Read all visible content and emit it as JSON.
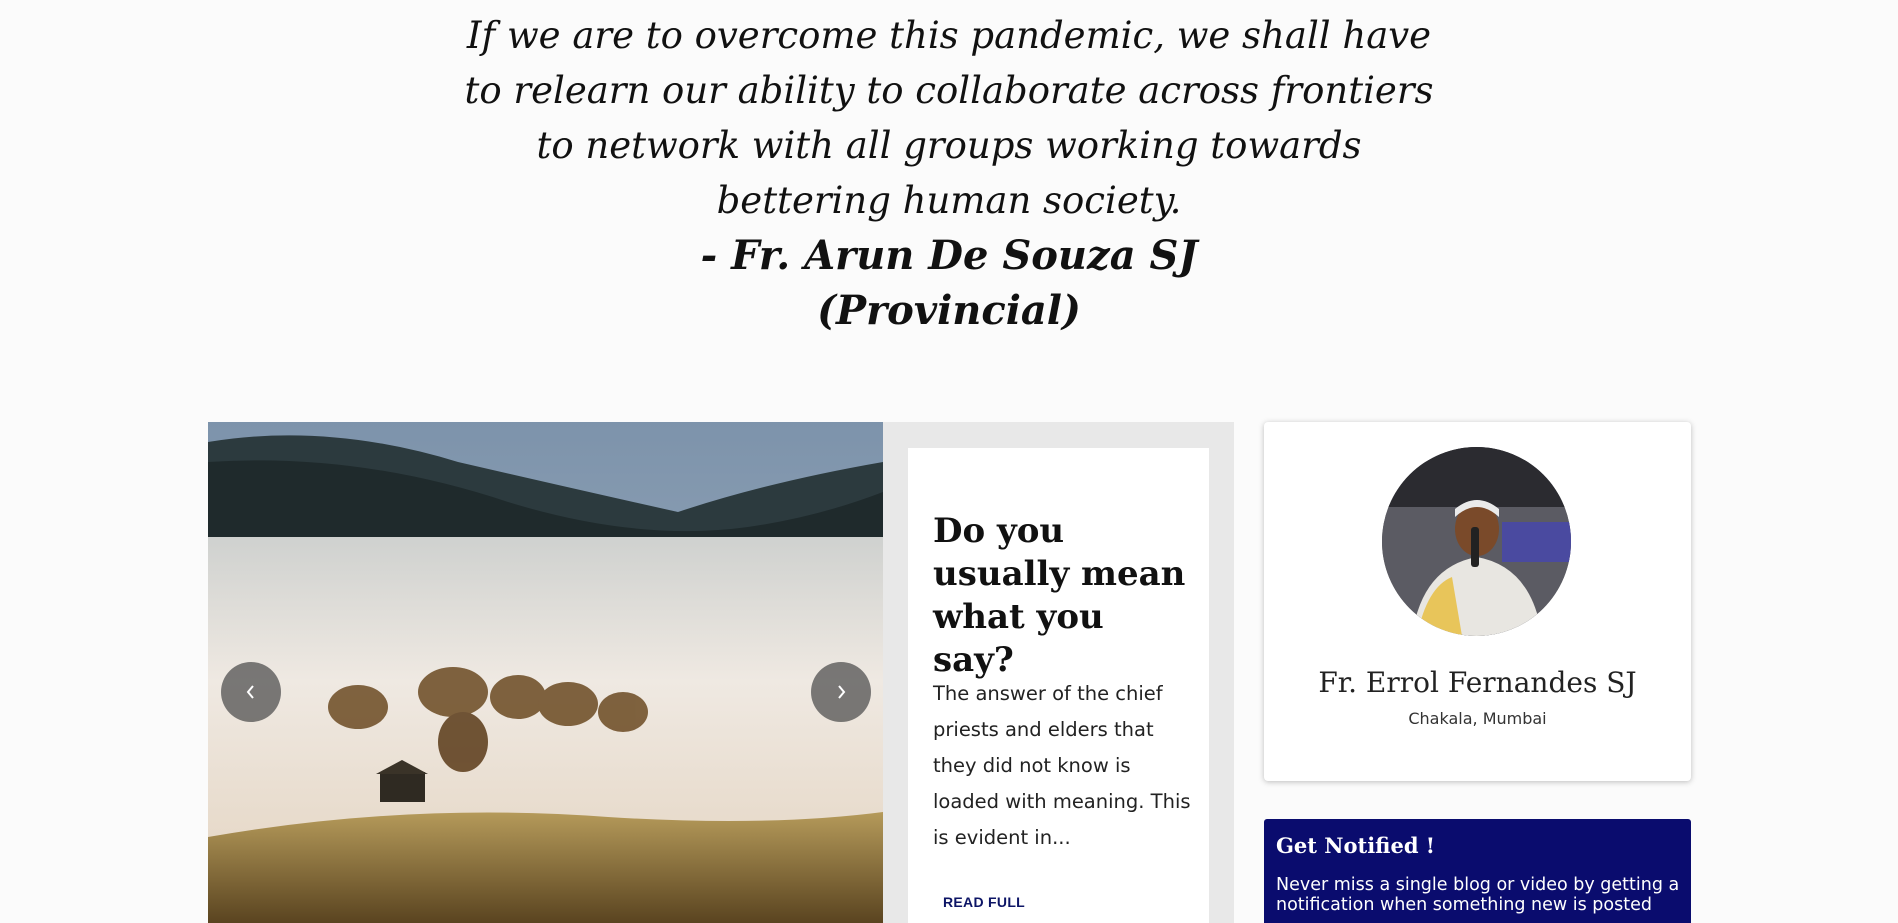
{
  "quote": {
    "text": "If we are to overcome this pandemic, we shall have to relearn our ability to collaborate across frontiers to network with all groups working towards bettering human society.",
    "author_line1": "- Fr. Arun De Souza SJ",
    "author_line2": "(Provincial)"
  },
  "carousel": {
    "image": "misty-landscape-image",
    "prev_icon": "chevron-left-icon",
    "next_icon": "chevron-right-icon"
  },
  "post": {
    "title": "Do you usually mean what you say?",
    "excerpt": "The answer of the chief priests and elders that they did not know is loaded with meaning. This is evident in...",
    "read_label": "READ FULL"
  },
  "profile": {
    "name": "Fr. Errol Fernandes SJ",
    "location": "Chakala, Mumbai"
  },
  "notify": {
    "title": "Get Notified !",
    "text": "Never miss a single blog or video by getting a notification when something new is posted"
  },
  "colors": {
    "accent": "#0a0c6e",
    "panel_bg": "#e8e8e8",
    "page_bg": "#fbfbfb"
  }
}
